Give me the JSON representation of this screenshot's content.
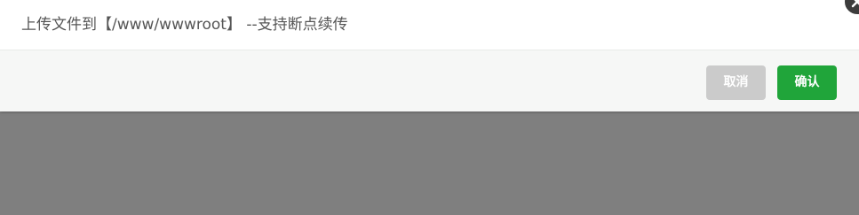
{
  "dialog": {
    "title": "上传文件到【/www/wwwroot】 --支持断点续传",
    "cancel_label": "取消",
    "confirm_label": "确认",
    "close_icon": "close-icon"
  },
  "colors": {
    "overlay": "#7f7f7f",
    "cancel_button": "#cbcbcb",
    "confirm_button": "#20a53a",
    "title_text": "#555555"
  }
}
